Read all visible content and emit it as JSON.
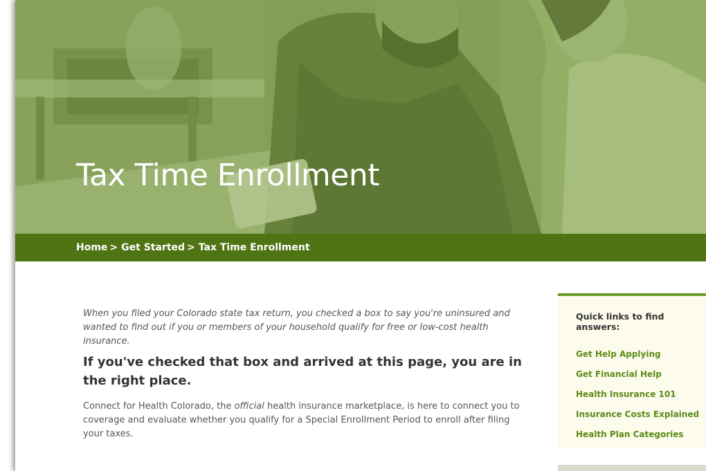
{
  "hero": {
    "title": "Tax Time Enrollment"
  },
  "breadcrumb": {
    "items": [
      "Home",
      "Get Started",
      "Tax Time Enrollment"
    ],
    "separator": ">"
  },
  "main": {
    "intro": "When you filed your Colorado state tax return, you checked a box to say you're uninsured and wanted to find out if you or members of your household qualify for free or low-cost health insurance.",
    "headline": "If you've checked that box and arrived at this page, you are in the right place.",
    "body_before": "Connect for Health Colorado, the ",
    "body_emphasis": "official",
    "body_after": " health insurance marketplace, is here to connect you to coverage and evaluate whether you qualify for a Special Enrollment Period to enroll after filing your taxes."
  },
  "sidebar": {
    "title": "Quick links to find answers:",
    "links": [
      "Get Help Applying",
      "Get Financial Help",
      "Health Insurance 101",
      "Insurance Costs Explained",
      "Health Plan Categories"
    ]
  },
  "colors": {
    "hero_tint": "#7f9a4e",
    "breadcrumb_bg": "#4f7413",
    "link": "#5a8b18",
    "sidebar_bg": "#fdfbeb",
    "sidebar_border": "#6e9a26"
  }
}
